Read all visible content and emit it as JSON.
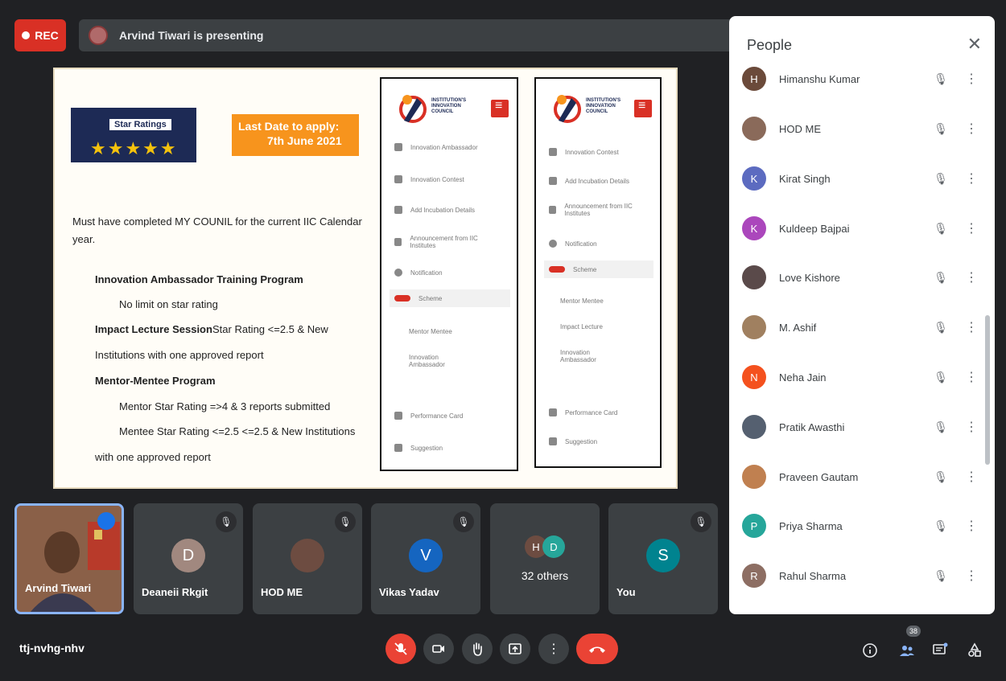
{
  "top": {
    "rec_label": "REC",
    "presenting_text": "Arvind Tiwari is presenting"
  },
  "slide": {
    "star_title": "Star Ratings",
    "stars": "★★★★★",
    "deadline_line1": "Last Date to apply:",
    "deadline_line2": "7th June 2021",
    "body": [
      "Must have completed MY COUNIL for the current IIC Calendar",
      "year.",
      "Innovation Ambassador Training Program",
      "No  limit on star rating",
      "Impact Lecture Session",
      "Star Rating <=2.5  & New",
      "Institutions with one approved report",
      "Mentor-Mentee Program",
      "Mentor Star Rating =>4  & 3 reports submitted",
      "Mentee  Star Rating <=2.5 <=2.5  & New Institutions",
      "with one approved report"
    ],
    "phone1_logo": "INSTITUTION'S INNOVATION COUNCIL",
    "phone1": [
      "Innovation Ambassador",
      "Innovation Contest",
      "Add Incubation Details",
      "Announcement from IIC Institutes",
      "Notification",
      "Scheme",
      "Mentor Mentee",
      "Innovation Ambassador",
      "Performance Card",
      "Suggestion"
    ],
    "phone2_logo": "INSTITUTION'S INNOVATION COUNCIL",
    "phone2": [
      "Innovation Contest",
      "Add Incubation Details",
      "Announcement from IIC Institutes",
      "Notification",
      "Scheme",
      "Mentor Mentee",
      "Impact Lecture",
      "Innovation Ambassador",
      "Performance Card",
      "Suggestion"
    ]
  },
  "tiles": {
    "self_name": "Arvind Tiwari",
    "t1": {
      "initial": "D",
      "name": "Deaneii Rkgit"
    },
    "t2": {
      "name": "HOD ME"
    },
    "t3": {
      "initial": "V",
      "name": "Vikas Yadav"
    },
    "t4": {
      "b1": "H",
      "b2": "D",
      "label": "32 others"
    },
    "t5": {
      "initial": "S",
      "name": "You"
    }
  },
  "people": {
    "title": "People",
    "list": [
      {
        "name": "Himanshu Kumar",
        "initial": "H",
        "color": "#6b4a3a"
      },
      {
        "name": "HOD ME",
        "initial": "",
        "color": "#8a6a5a"
      },
      {
        "name": "Kirat Singh",
        "initial": "K",
        "color": "#5c6bc0"
      },
      {
        "name": "Kuldeep Bajpai",
        "initial": "K",
        "color": "#ab47bc"
      },
      {
        "name": "Love Kishore",
        "initial": "",
        "color": "#5a4a4a"
      },
      {
        "name": "M. Ashif",
        "initial": "",
        "color": "#a08060"
      },
      {
        "name": "Neha Jain",
        "initial": "N",
        "color": "#f4511e"
      },
      {
        "name": "Pratik Awasthi",
        "initial": "",
        "color": "#556070"
      },
      {
        "name": "Praveen Gautam",
        "initial": "",
        "color": "#c08050"
      },
      {
        "name": "Priya Sharma",
        "initial": "P",
        "color": "#26a69a"
      },
      {
        "name": "Rahul Sharma",
        "initial": "R",
        "color": "#8d6e63"
      }
    ]
  },
  "bottom": {
    "meeting_code": "ttj-nvhg-nhv",
    "participant_count": "38"
  }
}
